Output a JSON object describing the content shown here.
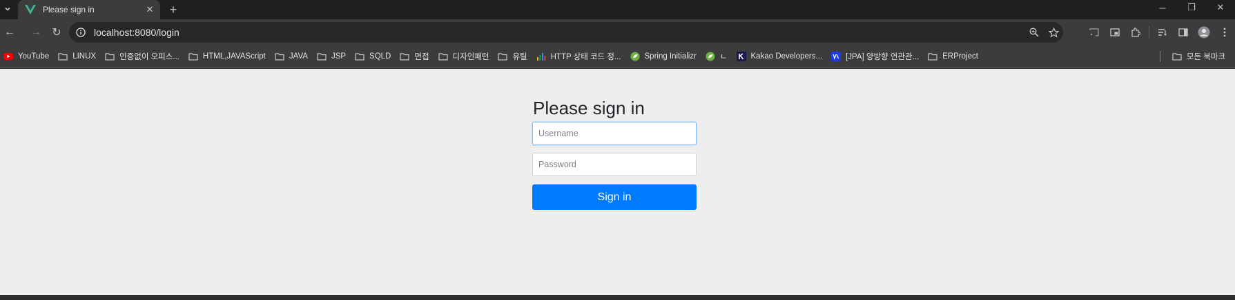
{
  "browser": {
    "tab": {
      "title": "Please sign in",
      "close_glyph": "✕",
      "favicon": "vue-logo-icon"
    },
    "new_tab_glyph": "+",
    "window_controls": [
      "─",
      "❐",
      "✕"
    ],
    "nav": {
      "back": "←",
      "forward": "→",
      "reload": "↻"
    },
    "address": {
      "url": "localhost:8080/login"
    },
    "colors": {
      "accent_blue": "#007bff",
      "page_bg": "#eeeeee",
      "chrome_dark": "#3c3c3c"
    }
  },
  "bookmarks": {
    "items": [
      {
        "label": "YouTube",
        "icon": "youtube-icon"
      },
      {
        "label": "LINUX",
        "icon": "folder-icon"
      },
      {
        "label": "인증없이 오피스...",
        "icon": "folder-icon"
      },
      {
        "label": "HTML,JAVAScript",
        "icon": "folder-icon"
      },
      {
        "label": "JAVA",
        "icon": "folder-icon"
      },
      {
        "label": "JSP",
        "icon": "folder-icon"
      },
      {
        "label": "SQLD",
        "icon": "folder-icon"
      },
      {
        "label": "면접",
        "icon": "folder-icon"
      },
      {
        "label": "디자인패턴",
        "icon": "folder-icon"
      },
      {
        "label": "유틸",
        "icon": "folder-icon"
      },
      {
        "label": "HTTP 상태 코드 정...",
        "icon": "bar-chart-icon"
      },
      {
        "label": "Spring Initializr",
        "icon": "spring-icon"
      },
      {
        "label": "ㄴ",
        "icon": "spring-icon"
      },
      {
        "label": "Kakao Developers...",
        "icon": "kakao-k-icon"
      },
      {
        "label": "[JPA] 양방향 연관관...",
        "icon": "velog-icon"
      },
      {
        "label": "ERProject",
        "icon": "folder-icon"
      }
    ],
    "all_bookmarks": "모든 북마크"
  },
  "login": {
    "heading": "Please sign in",
    "username_placeholder": "Username",
    "password_placeholder": "Password",
    "submit_label": "Sign in"
  }
}
